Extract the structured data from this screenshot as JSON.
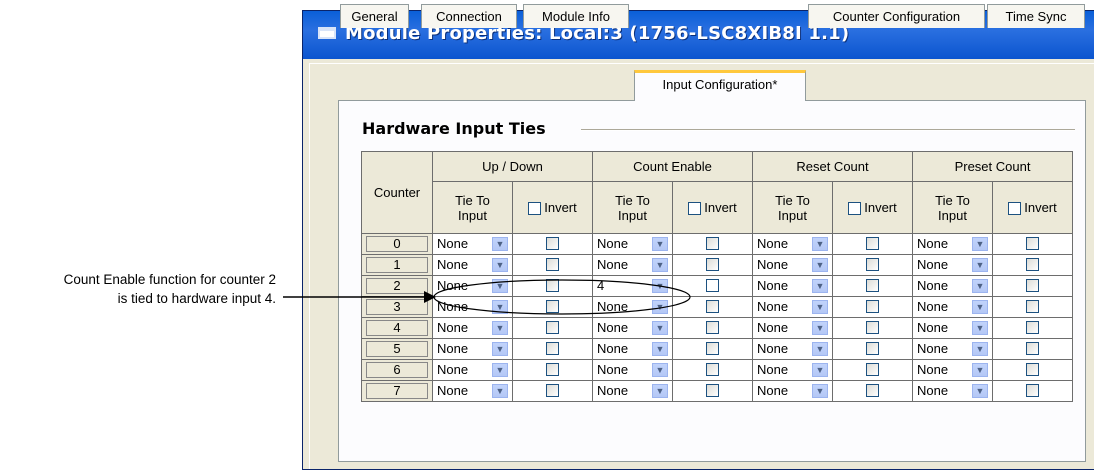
{
  "window": {
    "title": "Module Properties: Local:3 (1756-LSC8XIB8I 1.1)"
  },
  "tabs": [
    {
      "label": "General"
    },
    {
      "label": "Connection"
    },
    {
      "label": "Module Info"
    },
    {
      "label": "Input Configuration*"
    },
    {
      "label": "Counter Configuration"
    },
    {
      "label": "Time Sync"
    }
  ],
  "section": {
    "title": "Hardware Input Ties"
  },
  "grid": {
    "counter_header": "Counter",
    "groups": [
      "Up / Down",
      "Count Enable",
      "Reset Count",
      "Preset Count"
    ],
    "tie_label_1": "Tie To",
    "tie_label_2": "Input",
    "invert_label": "Invert",
    "rows": [
      {
        "counter": "0",
        "values": [
          "None",
          "None",
          "None",
          "None"
        ]
      },
      {
        "counter": "1",
        "values": [
          "None",
          "None",
          "None",
          "None"
        ]
      },
      {
        "counter": "2",
        "values": [
          "None",
          "4",
          "None",
          "None"
        ]
      },
      {
        "counter": "3",
        "values": [
          "None",
          "None",
          "None",
          "None"
        ]
      },
      {
        "counter": "4",
        "values": [
          "None",
          "None",
          "None",
          "None"
        ]
      },
      {
        "counter": "5",
        "values": [
          "None",
          "None",
          "None",
          "None"
        ]
      },
      {
        "counter": "6",
        "values": [
          "None",
          "None",
          "None",
          "None"
        ]
      },
      {
        "counter": "7",
        "values": [
          "None",
          "None",
          "None",
          "None"
        ]
      }
    ]
  },
  "callout": {
    "line1": "Count Enable function for counter 2",
    "line2": "is tied to hardware input 4."
  }
}
